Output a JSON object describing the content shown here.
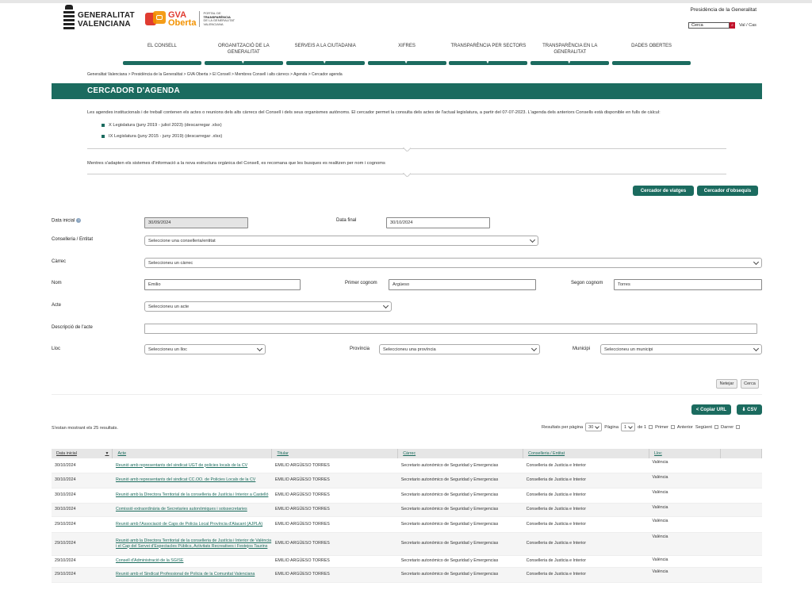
{
  "header": {
    "gv_logo_line1": "GENERALITAT",
    "gv_logo_line2": "VALENCIANA",
    "gvo_line1": "GVA",
    "gvo_line2": "Oberta",
    "gvo_portal_1": "PORTAL DE",
    "gvo_portal_2": "TRANSPARÈNCIA",
    "gvo_portal_3": "DE LA GENERALITAT",
    "gvo_portal_4": "VALENCIANA",
    "presidencia": "Presidència de la Generalitat",
    "search_value": "Cerca",
    "lang": "Val / Cas"
  },
  "nav": [
    {
      "label": "EL CONSELL"
    },
    {
      "label": "ORGANITZACIÓ DE LA GENERALITAT"
    },
    {
      "label": "SERVEIS A LA CIUTADANIA"
    },
    {
      "label": "XIFRES"
    },
    {
      "label": "TRANSPARÈNCIA PER SECTORS"
    },
    {
      "label": "TRANSPARÈNCIA EN LA GENERALITAT"
    },
    {
      "label": "DADES OBERTES"
    }
  ],
  "breadcrumb": "Generalitat Valenciana >  Presidència de la Generalitat   >  GVA Oberta   >  El Consell   >  Membres Consell i alts càrrecs  >  Agenda  >  Cercador agenda",
  "page_title": "CERCADOR D'AGENDA",
  "intro": "Les agendes institucionals i de treball contenen els actes o reunions dels alts càrrecs del Consell i dels seus organismes autònoms. El cercador permet la consulta dels actes de l'actual legislatura, a partir del 07-07-2023. L'agenda dels anteriors Consells està disponible en fulls de càlcul:",
  "legislatures": [
    {
      "text": "X Legislatura (juny 2019 - juliol 2023) (",
      "link": "descarregar .xlsx",
      "close": ")"
    },
    {
      "text": "IX Legislatura (juny 2015 - juny 2019) (",
      "link": "descarregar .xlsx",
      "close": ")"
    }
  ],
  "notice": "Mentres s'adapten els sistemes d'informació a la nova estructura orgànica del Consell, es recomana que les busques es realitzen per nom i cognoms",
  "buttons": {
    "viatges": "Cercador de viatges",
    "obsequis": "Cercador d'obsequis",
    "netejar": "Netejar",
    "cerca": "Cerca",
    "copiar_url": "Copiar URL",
    "csv": "CSV"
  },
  "form": {
    "data_inicial_label": "Data inicial",
    "data_inicial_value": "30/09/2024",
    "data_final_label": "Data final",
    "data_final_value": "30/10/2024",
    "conselleria_label": "Conselleria / Entitat",
    "conselleria_value": "Seleccione una conselleria/entitat",
    "carrec_label": "Càrrec",
    "carrec_value": "Seleccioneu un càrrec",
    "nom_label": "Nom",
    "nom_value": "Emilio",
    "primer_label": "Primer cognom",
    "primer_value": "Argüeso",
    "segon_label": "Segon cognom",
    "segon_value": "Torres",
    "acte_label": "Acte",
    "acte_value": "Seleccioneu un acte",
    "descripcio_label": "Descripció de l'acte",
    "descripcio_value": "",
    "lloc_label": "Lloc",
    "lloc_value": "Seleccioneu un lloc",
    "provincia_label": "Província",
    "provincia_value": "Seleccioneu una província",
    "municipi_label": "Municipi",
    "municipi_value": "Seleccioneu un municipi"
  },
  "results": {
    "count_text": "S'estan mostrant els 25 resultats.",
    "per_page_label": "Resultats per pàgina",
    "per_page_value": "30",
    "page_label": "Pàgina",
    "page_value": "1",
    "of_text": "de 1",
    "first": "Primer",
    "prev": "Anterior",
    "next": "Següent",
    "last": "Darrer"
  },
  "table": {
    "headers": [
      "Data inicial",
      "Acte",
      "Titular",
      "Càrrec",
      "Conselleria / Entitat",
      "Lloc"
    ],
    "rows": [
      {
        "date": "30/10/2024",
        "acte": "Reunió amb representants del sindicat UGT de policies locals de la CV",
        "titular": "EMILIO ARGÜESO TORRES",
        "carrec": "Secretario autonómico de Seguridad y Emergencias",
        "conselleria": "Conselleria de Justicia e Interior",
        "lloc": "València"
      },
      {
        "date": "30/10/2024",
        "acte": "Reunió amb representants del sindicat CC.OO. de Policies Locals de la CV",
        "titular": "EMILIO ARGÜESO TORRES",
        "carrec": "Secretario autonómico de Seguridad y Emergencias",
        "conselleria": "Conselleria de Justicia e Interior",
        "lloc": "València"
      },
      {
        "date": "30/10/2024",
        "acte": "Reunió amb la Directora Territorial de la conselleria de Justícia i Interior a Castelló",
        "titular": "EMILIO ARGÜESO TORRES",
        "carrec": "Secretario autonómico de Seguridad y Emergencias",
        "conselleria": "Conselleria de Justicia e Interior",
        "lloc": "València"
      },
      {
        "date": "30/10/2024",
        "acte": "Comissió extraordinària de Secretaries autonòmiques i sotssecretaries",
        "titular": "EMILIO ARGÜESO TORRES",
        "carrec": "Secretario autonómico de Seguridad y Emergencias",
        "conselleria": "Conselleria de Justicia e Interior",
        "lloc": "València"
      },
      {
        "date": "29/10/2024",
        "acte": "Reunió amb l'Associació de Caps de Policia Local Província d'Alacant (AJPLA)",
        "titular": "EMILIO ARGÜESO TORRES",
        "carrec": "Secretario autonómico de Seguridad y Emergencias",
        "conselleria": "Conselleria de Justicia e Interior",
        "lloc": "València"
      },
      {
        "date": "29/10/2024",
        "acte": "Reunió amb la Directora Territorial de la conselleria de Justícia i Interior de València i el Cap del Servei d'Espectacles Públics, Activitats Recreatives i Festejos Taurins",
        "titular": "EMILIO ARGÜESO TORRES",
        "carrec": "Secretario autonómico de Seguridad y Emergencias",
        "conselleria": "Conselleria de Justicia e Interior",
        "lloc": "València"
      },
      {
        "date": "29/10/2024",
        "acte": "Consell d'Administració de la SGISE",
        "titular": "EMILIO ARGÜESO TORRES",
        "carrec": "Secretario autonómico de Seguridad y Emergencias",
        "conselleria": "Conselleria de Justicia e Interior",
        "lloc": "València"
      },
      {
        "date": "29/10/2024",
        "acte": "Reunió amb el Sindicat Professional de Policia de la Comunitat Valenciana",
        "titular": "EMILIO ARGÜESO TORRES",
        "carrec": "Secretario autonómico de Seguridad y Emergencias",
        "conselleria": "Conselleria de Justicia e Interior",
        "lloc": "València"
      }
    ]
  },
  "colors": {
    "accent": "#1b6b5f",
    "link": "#1a6b5c",
    "gvo_red": "#e03c31",
    "gvo_orange": "#f39200"
  }
}
